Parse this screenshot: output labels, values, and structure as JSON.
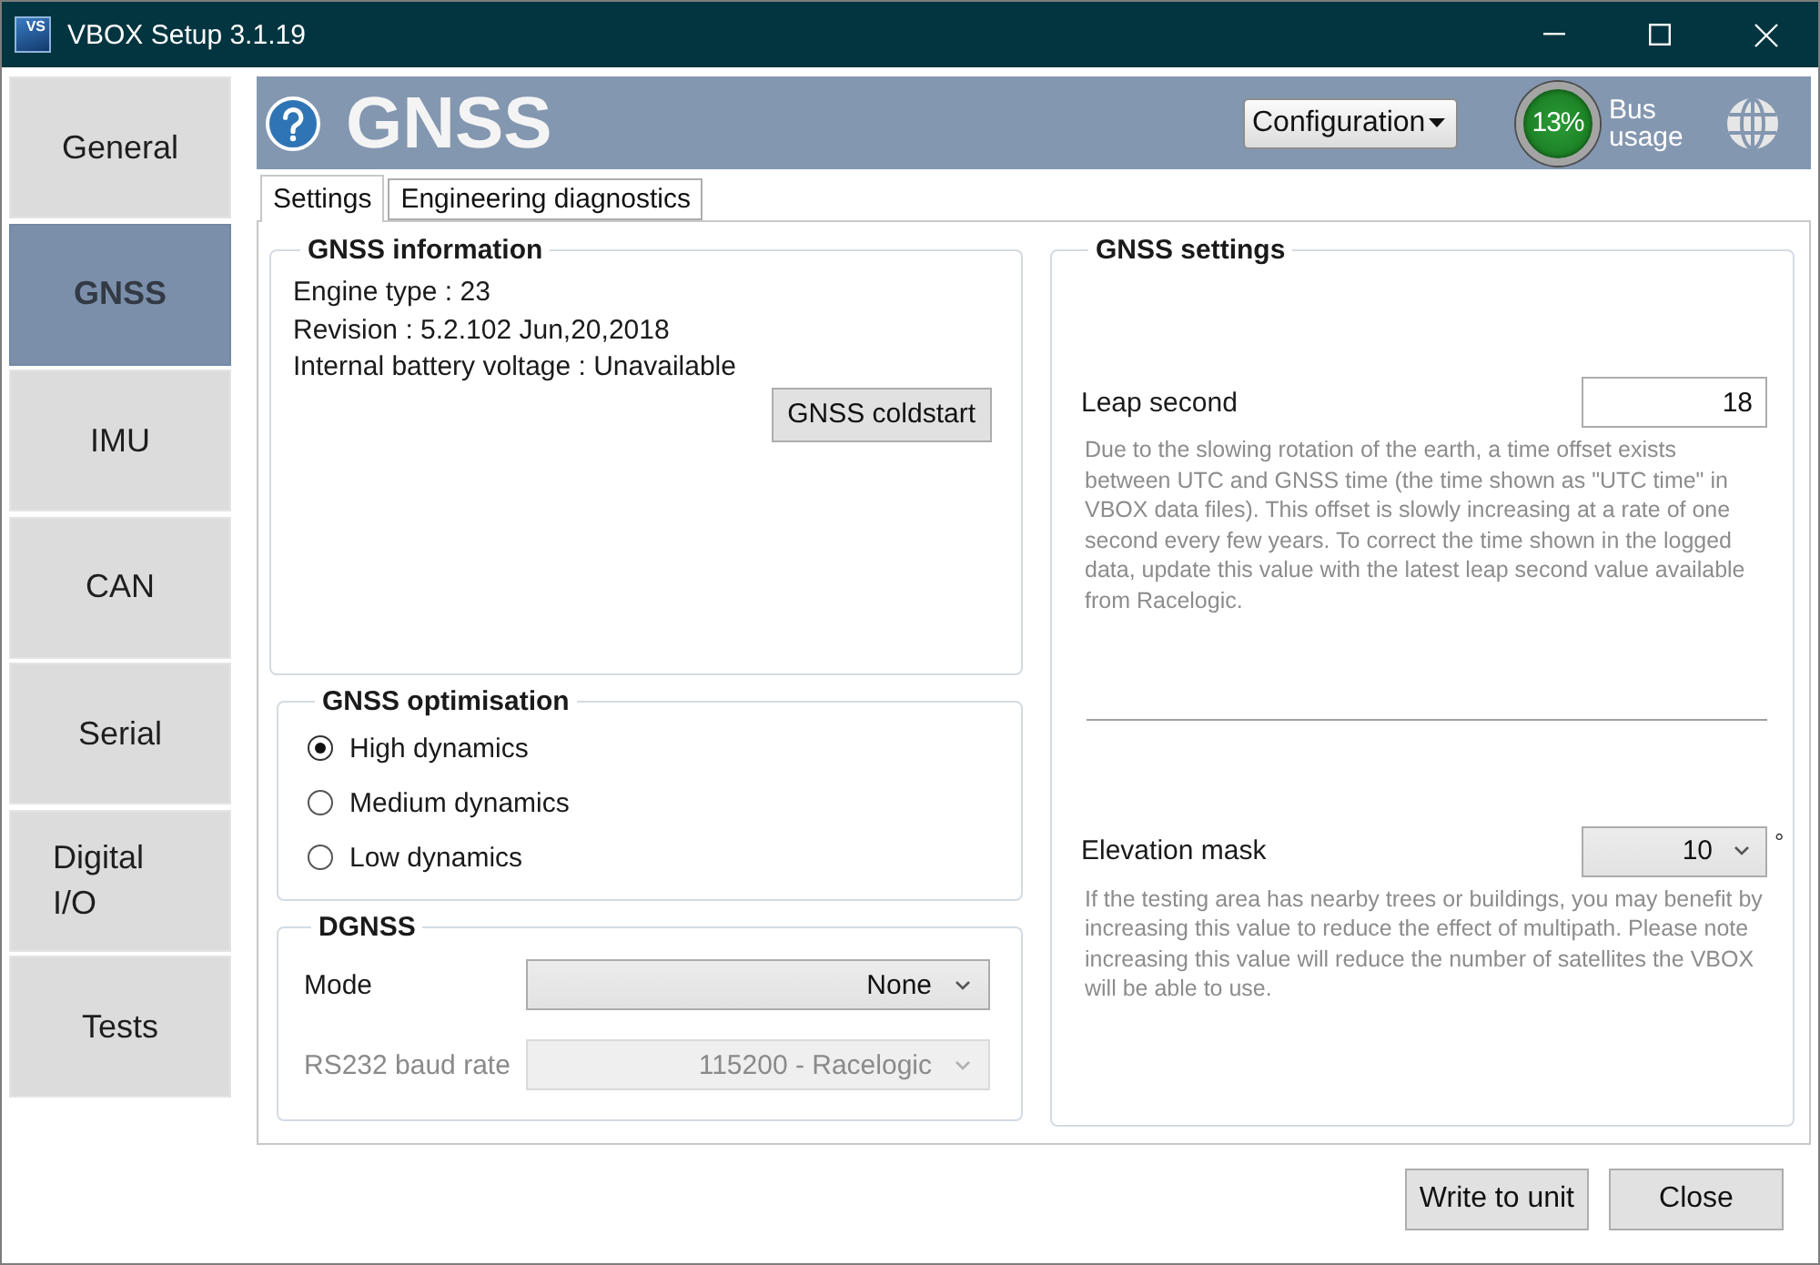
{
  "window": {
    "title": "VBOX Setup 3.1.19",
    "logo_text": "VS"
  },
  "sidebar": {
    "items": [
      {
        "label": "General",
        "selected": false
      },
      {
        "label": "GNSS",
        "selected": true
      },
      {
        "label": "IMU",
        "selected": false
      },
      {
        "label": "CAN",
        "selected": false
      },
      {
        "label": "Serial",
        "selected": false
      },
      {
        "label": "Digital I/O",
        "selected": false
      },
      {
        "label": "Tests",
        "selected": false
      }
    ]
  },
  "header": {
    "title": "GNSS",
    "menu": "Configuration",
    "bus_usage": {
      "value": "13%",
      "label": "Bus usage"
    }
  },
  "tabs": [
    {
      "label": "Settings",
      "selected": true
    },
    {
      "label": "Engineering diagnostics",
      "selected": false
    }
  ],
  "gnss_information": {
    "title": "GNSS information",
    "lines": [
      "Engine type : 23",
      "Revision : 5.2.102 Jun,20,2018",
      "Internal battery voltage : Unavailable"
    ],
    "button": "GNSS coldstart"
  },
  "gnss_optimisation": {
    "title": "GNSS optimisation",
    "options": [
      {
        "label": "High dynamics",
        "selected": true
      },
      {
        "label": "Medium dynamics",
        "selected": false
      },
      {
        "label": "Low dynamics",
        "selected": false
      }
    ]
  },
  "dgnss": {
    "title": "DGNSS",
    "fields": [
      {
        "label": "Mode",
        "value": "None",
        "disabled": false
      },
      {
        "label": "RS232 baud rate",
        "value": "115200 - Racelogic",
        "disabled": true
      }
    ]
  },
  "gnss_settings": {
    "title": "GNSS settings",
    "settings": [
      {
        "kind": "input",
        "label": "Leap second",
        "value": "18",
        "description": "Due to the slowing rotation of the earth, a time offset exists between UTC and GNSS time (the time shown as \"UTC time\" in VBOX data files). This offset is slowly increasing at a rate of one second every few years. To correct the time shown in the logged data, update this value with the latest leap second value available from Racelogic."
      },
      {
        "kind": "dropdown",
        "label": "Elevation mask",
        "value": "10",
        "unit": "°",
        "description": "If the testing area has nearby trees or buildings, you may benefit by increasing this value to reduce the effect of multipath. Please note increasing this value will reduce the number of satellites the VBOX will be able to use."
      }
    ]
  },
  "buttons": [
    "Write to unit",
    "Close"
  ]
}
